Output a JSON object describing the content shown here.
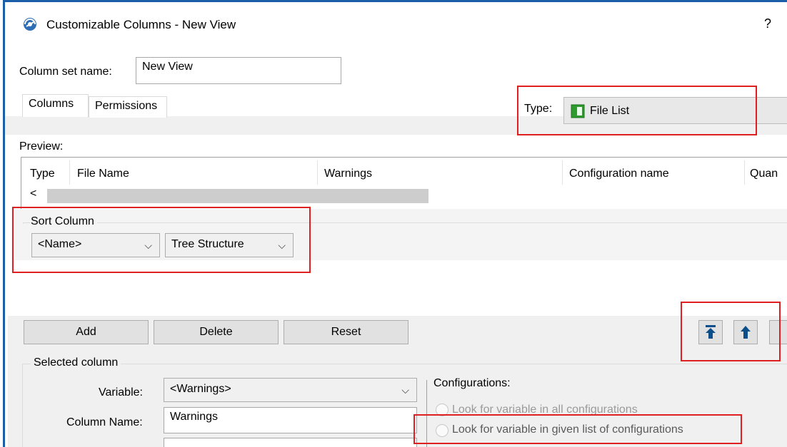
{
  "window": {
    "title": "Customizable Columns - New View",
    "help": "?"
  },
  "column_set": {
    "label": "Column set name:",
    "value": "New View"
  },
  "tabs": [
    {
      "label": "Columns"
    },
    {
      "label": "Permissions"
    }
  ],
  "type": {
    "label": "Type:",
    "value": "File List"
  },
  "preview": {
    "label": "Preview:",
    "columns": [
      "Type",
      "File Name",
      "Warnings",
      "Configuration name",
      "Quan"
    ],
    "scroll_left": "<"
  },
  "sort": {
    "label": "Sort Column",
    "field": "<Name>",
    "order": "Tree Structure"
  },
  "buttons": {
    "add": "Add",
    "delete": "Delete",
    "reset": "Reset"
  },
  "selected_column": {
    "label": "Selected column",
    "variable_label": "Variable:",
    "variable_value": "<Warnings>",
    "column_name_label": "Column Name:",
    "column_name_value": "Warnings"
  },
  "configurations": {
    "label": "Configurations:",
    "option_all": "Look for variable in all configurations",
    "option_given": "Look for variable in given list of configurations"
  },
  "icons": {
    "move_top": "move-to-top-icon",
    "move_up": "move-up-icon"
  },
  "colors": {
    "highlight": "#e02020",
    "accent": "#1b5fa8",
    "file_list_icon": "#2e9b2e"
  }
}
